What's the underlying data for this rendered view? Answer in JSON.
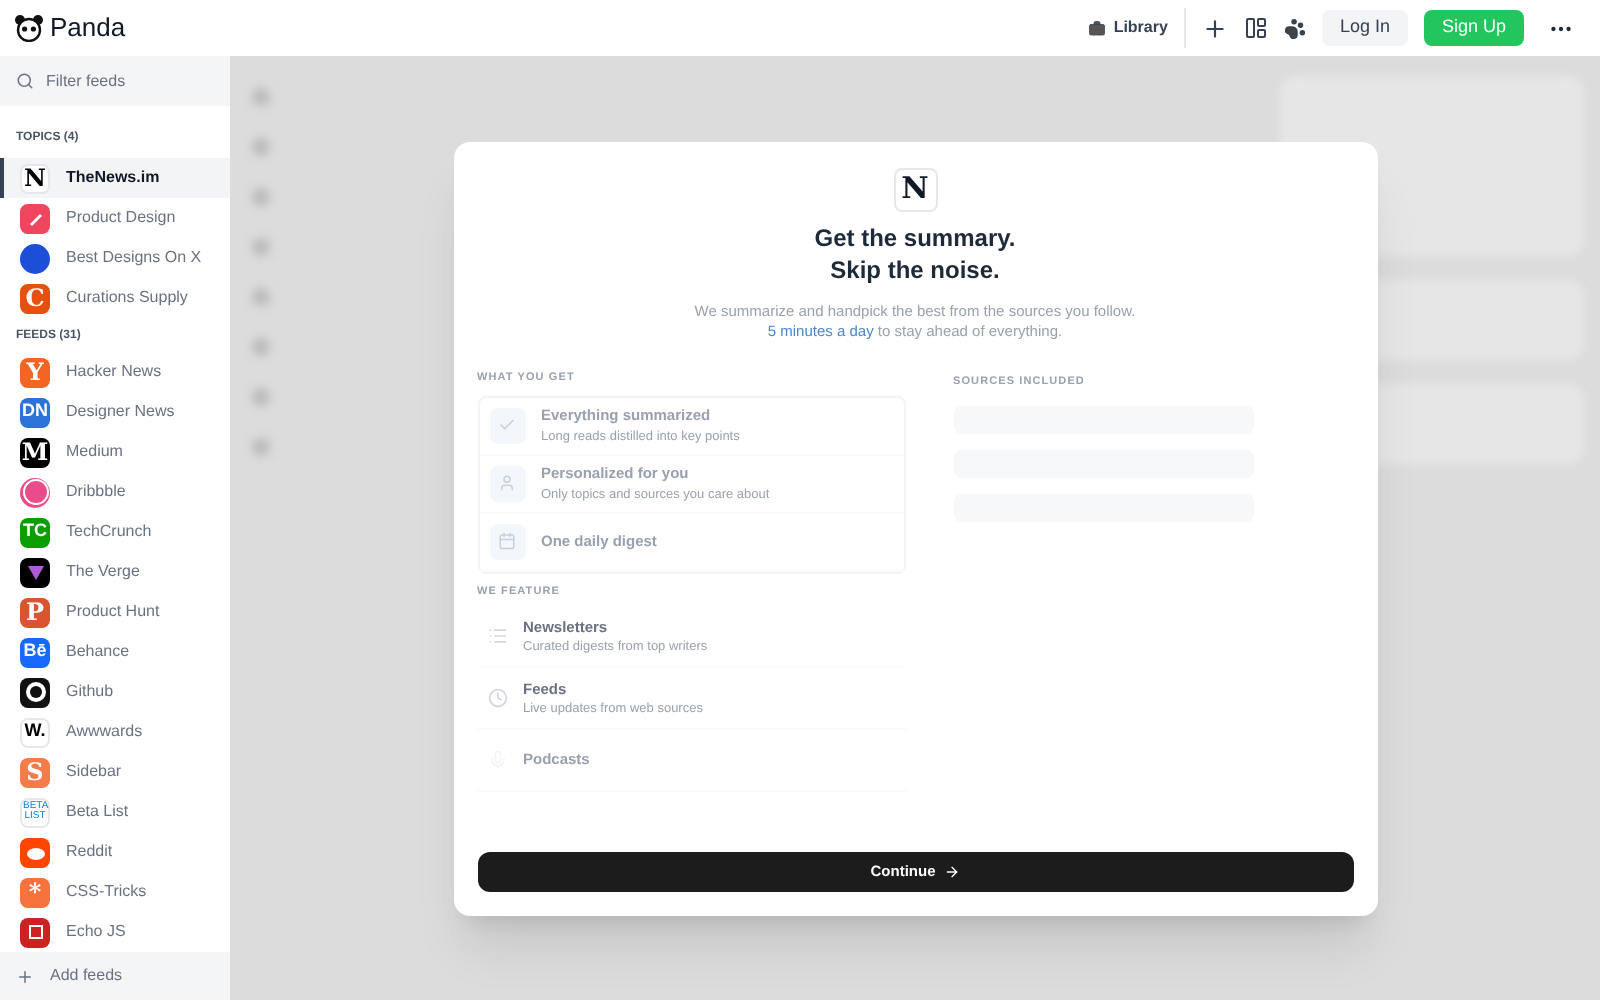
{
  "app": {
    "name": "Panda"
  },
  "header": {
    "library": "Library",
    "login": "Log In",
    "signup": "Sign Up"
  },
  "sidebar": {
    "filter_placeholder": "Filter feeds",
    "topics_label": "TOPICS (4)",
    "topics": [
      {
        "label": "TheNews.im",
        "selected": true,
        "color": "#ffffff",
        "glyph": "N"
      },
      {
        "label": "Product Design",
        "selected": false,
        "color": "#f0455e",
        "kind": "pencil"
      },
      {
        "label": "Best Designs On X",
        "selected": false,
        "color": "#1d4ed8",
        "kind": "dot"
      },
      {
        "label": "Curations Supply",
        "selected": false,
        "color": "#e8500f",
        "glyph": "C"
      }
    ],
    "feeds_label": "FEEDS (31)",
    "feeds": [
      {
        "label": "Hacker News",
        "selected": false,
        "color": "#f26522",
        "glyph": "Y"
      },
      {
        "label": "Designer News",
        "selected": false,
        "color": "#2d72d9",
        "glyph": "DN"
      },
      {
        "label": "Medium",
        "selected": false,
        "color": "#000000",
        "glyph": "M"
      },
      {
        "label": "Dribbble",
        "selected": false,
        "color": "#ea4c89",
        "kind": "ball"
      },
      {
        "label": "TechCrunch",
        "selected": false,
        "color": "#0a9e01",
        "glyph": "TC"
      },
      {
        "label": "The Verge",
        "selected": false,
        "color": "#000000",
        "kind": "triangle"
      },
      {
        "label": "Product Hunt",
        "selected": false,
        "color": "#da552f",
        "glyph": "P"
      },
      {
        "label": "Behance",
        "selected": false,
        "color": "#1769ff",
        "glyph": "Bē"
      },
      {
        "label": "Github",
        "selected": false,
        "color": "#111111",
        "kind": "cat"
      },
      {
        "label": "Awwwards",
        "selected": false,
        "color": "#ffffff",
        "glyph": "W."
      },
      {
        "label": "Sidebar",
        "selected": false,
        "color": "#f47c48",
        "glyph": "S"
      },
      {
        "label": "Beta List",
        "selected": false,
        "color": "#ffffff",
        "glyph": "BETA LIST"
      },
      {
        "label": "Reddit",
        "selected": false,
        "color": "#ff4500",
        "kind": "alien"
      },
      {
        "label": "CSS-Tricks",
        "selected": false,
        "color": "#f7723d",
        "glyph": "*"
      },
      {
        "label": "Echo JS",
        "selected": false,
        "color": "#cc2222",
        "kind": "square"
      }
    ],
    "add": "Add feeds"
  },
  "modal": {
    "logo": "N",
    "title_1": "Get the summary.",
    "title_2": "Skip the noise.",
    "intro": "We summarize and handpick the best from the sources you follow.",
    "highlight": "5 minutes a day",
    "intro_rest": " to stay ahead of everything.",
    "get_label": "WHAT YOU GET",
    "benefits": [
      {
        "title": "Everything summarized",
        "subtitle": "Long reads distilled into key points",
        "kind": "check"
      },
      {
        "title": "Personalized for you",
        "subtitle": "Only topics and sources you care about",
        "kind": "person"
      },
      {
        "title": "One daily digest",
        "kind": "calendar"
      }
    ],
    "sources_label": "SOURCES INCLUDED",
    "feature_label": "WE FEATURE",
    "features": [
      {
        "title": "Newsletters",
        "subtitle": "Curated digests from top writers",
        "kind": "list"
      },
      {
        "title": "Feeds",
        "subtitle": "Live updates from web sources",
        "kind": "clock"
      },
      {
        "title": "Podcasts",
        "kind": "mic"
      }
    ],
    "continue": "Continue"
  }
}
